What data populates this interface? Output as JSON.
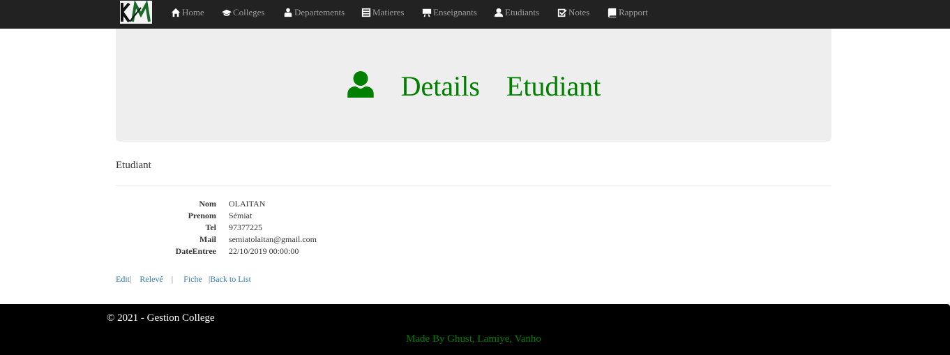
{
  "nav": {
    "items": [
      {
        "label": "Home",
        "icon": "home-icon"
      },
      {
        "label": "Colleges",
        "icon": "graduation-cap-icon"
      },
      {
        "label": "Departements",
        "icon": "user-tie-icon"
      },
      {
        "label": "Matieres",
        "icon": "list-alt-icon"
      },
      {
        "label": "Enseignants",
        "icon": "blackboard-icon"
      },
      {
        "label": "Etudiants",
        "icon": "user-icon"
      },
      {
        "label": "Notes",
        "icon": "check-icon"
      },
      {
        "label": "Rapport",
        "icon": "book-icon"
      }
    ]
  },
  "jumbotron": {
    "icon": "user-icon",
    "title_word1": "Details",
    "title_word2": "Etudiant",
    "accent_color": "#008000"
  },
  "section": {
    "title": "Etudiant"
  },
  "details": {
    "nom_label": "Nom",
    "nom_value": "OLAITAN",
    "prenom_label": "Prenom",
    "prenom_value": "Sémiat",
    "tel_label": "Tel",
    "tel_value": "97377225",
    "mail_label": "Mail",
    "mail_value": "semiatolaitan@gmail.com",
    "date_label": "DateEntree",
    "date_value": "22/10/2019 00:00:00"
  },
  "actions": {
    "edit": "Edit",
    "releve": "Relevé",
    "fiche": "Fiche",
    "back": "Back to List",
    "sep": "|"
  },
  "footer": {
    "copyright": "© 2021 - Gestion College",
    "made_by": "Made By Ghust, Lamiye, Vanho"
  }
}
